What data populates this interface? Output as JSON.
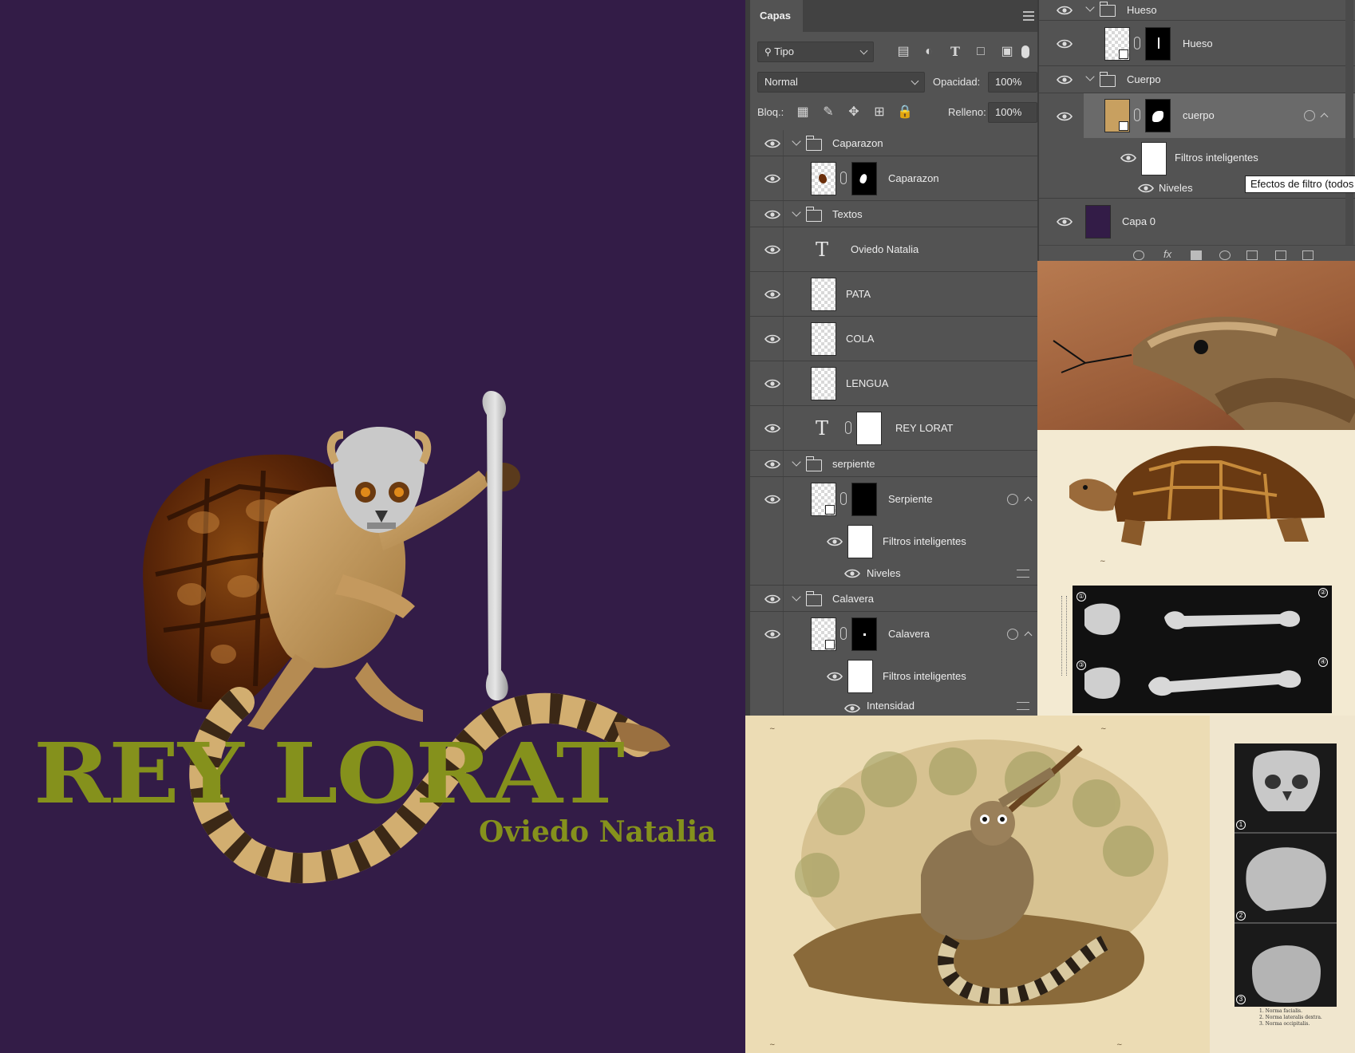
{
  "artwork": {
    "title": "REY LORAT",
    "author": "Oviedo Natalia",
    "background": "#331c47",
    "title_color": "#85911c"
  },
  "panel": {
    "tab": "Capas",
    "filter": "Tipo",
    "blend_mode": "Normal",
    "opacity_label": "Opacidad:",
    "opacity_value": "100%",
    "lock_label": "Bloq.:",
    "fill_label": "Relleno:",
    "fill_value": "100%"
  },
  "layers_left": [
    {
      "name": "Caparazon",
      "kind": "group"
    },
    {
      "name": "Caparazon",
      "kind": "layer"
    },
    {
      "name": "Textos",
      "kind": "group"
    },
    {
      "name": "Oviedo Natalia",
      "kind": "text"
    },
    {
      "name": "PATA",
      "kind": "layer"
    },
    {
      "name": "COLA",
      "kind": "layer"
    },
    {
      "name": "LENGUA",
      "kind": "layer"
    },
    {
      "name": "REY LORAT",
      "kind": "text"
    },
    {
      "name": "serpiente",
      "kind": "group"
    },
    {
      "name": "Serpiente",
      "kind": "smart"
    },
    {
      "name": "Filtros inteligentes",
      "kind": "filters"
    },
    {
      "name": "Niveles",
      "kind": "filter"
    },
    {
      "name": "Calavera",
      "kind": "group"
    },
    {
      "name": "Calavera",
      "kind": "smart"
    },
    {
      "name": "Filtros inteligentes",
      "kind": "filters"
    },
    {
      "name": "Intensidad",
      "kind": "filter"
    }
  ],
  "layers_right": [
    {
      "name": "Hueso",
      "kind": "group"
    },
    {
      "name": "Hueso",
      "kind": "layer"
    },
    {
      "name": "Cuerpo",
      "kind": "group"
    },
    {
      "name": "cuerpo",
      "kind": "smart"
    },
    {
      "name": "Filtros inteligentes",
      "kind": "filters"
    },
    {
      "name": "Niveles",
      "kind": "filter"
    },
    {
      "name": "Capa 0",
      "kind": "layer"
    }
  ],
  "tooltip": "Efectos de filtro (todos",
  "icons": [
    "search-icon",
    "eye-icon",
    "folder-icon",
    "link-icon",
    "lock-icon",
    "text-tool-icon",
    "smart-object-icon",
    "filter-settings-icon",
    "trash-icon"
  ],
  "references": {
    "bones_legend": [
      "①",
      "②",
      "③",
      "④"
    ],
    "skull_legend": [
      "1",
      "2",
      "3"
    ],
    "skull_notes": [
      "1. Norma facialis.",
      "2. Norma lateralis dextra.",
      "3. Norma occipitalis."
    ]
  }
}
